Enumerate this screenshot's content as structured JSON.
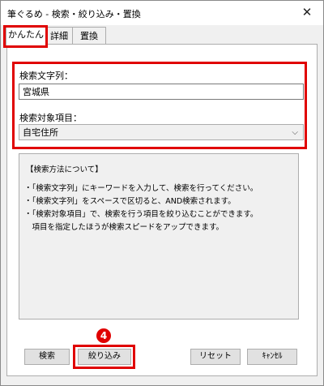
{
  "window": {
    "title": "筆ぐるめ - 検索・絞り込み・置換",
    "close_glyph": "✕"
  },
  "tabs": [
    {
      "label": "かんたん",
      "active": true
    },
    {
      "label": "詳細",
      "active": false
    },
    {
      "label": "置換",
      "active": false
    }
  ],
  "search": {
    "text_label": "検索文字列：",
    "text_value": "宮城県",
    "target_label": "検索対象項目：",
    "target_value": "自宅住所",
    "chevron_glyph": "⌵"
  },
  "help": {
    "heading": "【検索方法について】",
    "lines": [
      "・「検索文字列」にキーワードを入力して、検索を行ってください。",
      "・「検索文字列」をスペースで区切ると、AND検索されます。",
      "・「検索対象項目」で、検索を行う項目を絞り込むことができます。",
      "　項目を指定したほうが検索スピードをアップできます。"
    ]
  },
  "buttons": {
    "search": "検索",
    "filter": "絞り込み",
    "reset": "リセット",
    "cancel": "ｷｬﾝｾﾙ"
  },
  "annotation": {
    "step_number": "4"
  },
  "colors": {
    "highlight": "#e00000"
  }
}
